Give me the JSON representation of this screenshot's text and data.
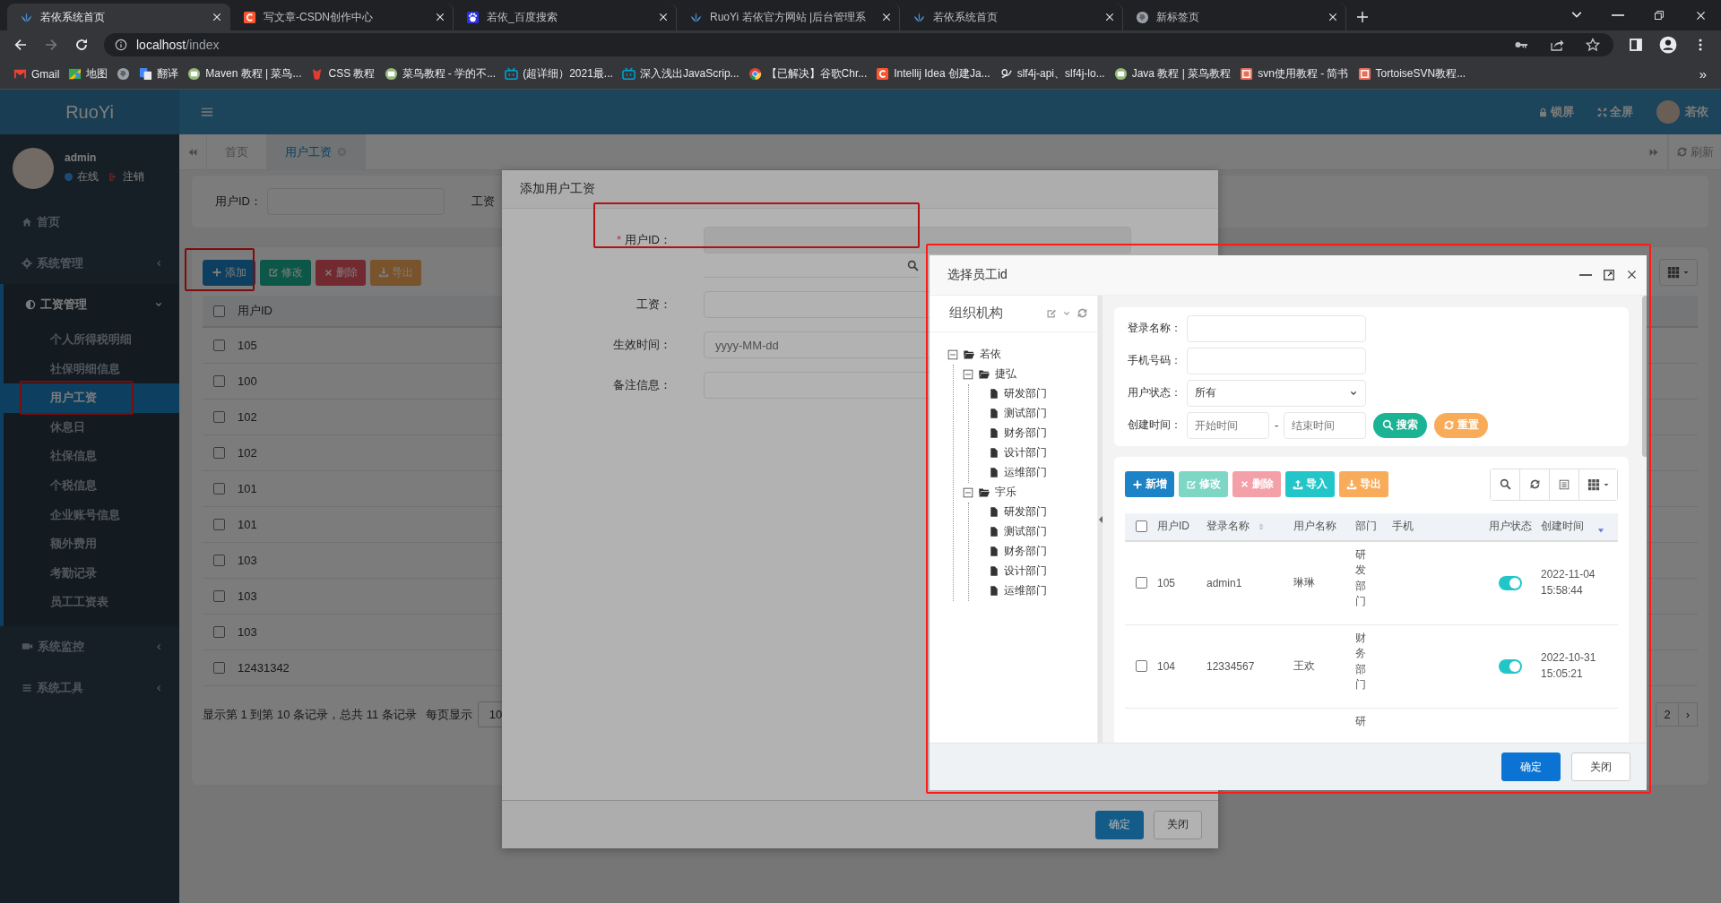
{
  "browser": {
    "tabs": [
      {
        "title": "若依系统首页",
        "selected": true
      },
      {
        "title": "写文章-CSDN创作中心",
        "selected": false
      },
      {
        "title": "若依_百度搜索",
        "selected": false
      },
      {
        "title": "RuoYi 若依官方网站 |后台管理系",
        "selected": false
      },
      {
        "title": "若依系统首页",
        "selected": false
      },
      {
        "title": "新标签页",
        "selected": false
      }
    ],
    "address_host": "localhost",
    "address_path": "/index",
    "bookmarks": [
      {
        "kind": "link",
        "label": "Gmail"
      },
      {
        "kind": "link",
        "label": "地图"
      },
      {
        "kind": "icon"
      },
      {
        "kind": "link",
        "label": "翻译"
      },
      {
        "kind": "link",
        "label": "Maven 教程 | 菜鸟..."
      },
      {
        "kind": "link",
        "label": "CSS 教程"
      },
      {
        "kind": "link",
        "label": "菜鸟教程 - 学的不..."
      },
      {
        "kind": "link",
        "label": "(超详细）2021最..."
      },
      {
        "kind": "link",
        "label": "深入浅出JavaScrip..."
      },
      {
        "kind": "link",
        "label": "【已解决】谷歌Chr..."
      },
      {
        "kind": "link",
        "label": "Intellij Idea 创建Ja..."
      },
      {
        "kind": "link",
        "label": "slf4j-api、slf4j-lo..."
      },
      {
        "kind": "link",
        "label": "Java 教程 | 菜鸟教程"
      },
      {
        "kind": "link",
        "label": "svn使用教程 - 简书"
      },
      {
        "kind": "link",
        "label": "TortoiseSVN教程..."
      }
    ],
    "more": "»"
  },
  "sidebar": {
    "logo": "RuoYi",
    "user": {
      "name": "admin",
      "status": "在线",
      "logout": "注销"
    },
    "items": [
      {
        "label": "首页"
      },
      {
        "label": "系统管理",
        "expanded": false
      },
      {
        "label": "工资管理",
        "expanded": true,
        "children": [
          {
            "label": "个人所得税明细",
            "selected": false
          },
          {
            "label": "社保明细信息",
            "selected": false
          },
          {
            "label": "用户工资",
            "selected": true,
            "highlighted": true
          },
          {
            "label": "休息日",
            "selected": false
          },
          {
            "label": "社保信息",
            "selected": false
          },
          {
            "label": "个税信息",
            "selected": false
          },
          {
            "label": "企业账号信息",
            "selected": false
          },
          {
            "label": "额外费用",
            "selected": false
          },
          {
            "label": "考勤记录",
            "selected": false
          },
          {
            "label": "员工工资表",
            "selected": false
          }
        ]
      },
      {
        "label": "系统监控",
        "expanded": false
      },
      {
        "label": "系统工具",
        "expanded": false
      }
    ]
  },
  "header": {
    "actions": [
      {
        "label": "锁屏"
      },
      {
        "label": "全屏"
      }
    ],
    "user": "若依"
  },
  "page_tabs": [
    {
      "label": "首页",
      "selected": false,
      "closable": false
    },
    {
      "label": "用户工资",
      "selected": true,
      "closable": true
    }
  ],
  "refresh": "刷新",
  "search": {
    "fields": [
      {
        "label": "用户ID："
      },
      {
        "label": "工资"
      }
    ]
  },
  "toolbar": [
    {
      "label": "添加",
      "kind": "primary",
      "highlighted": true
    },
    {
      "label": "修改",
      "kind": "success",
      "highlighted": false
    },
    {
      "label": "删除",
      "kind": "danger",
      "highlighted": false
    },
    {
      "label": "导出",
      "kind": "warning",
      "highlighted": false
    }
  ],
  "table": {
    "header_checked": false,
    "columns": [
      "用户ID"
    ],
    "rows": [
      {
        "cells": [
          "105"
        ],
        "checked": false
      },
      {
        "cells": [
          "100"
        ],
        "checked": false
      },
      {
        "cells": [
          "102"
        ],
        "checked": false
      },
      {
        "cells": [
          "102"
        ],
        "checked": false
      },
      {
        "cells": [
          "101"
        ],
        "checked": false
      },
      {
        "cells": [
          "101"
        ],
        "checked": false
      },
      {
        "cells": [
          "103"
        ],
        "checked": false
      },
      {
        "cells": [
          "103"
        ],
        "checked": false
      },
      {
        "cells": [
          "103"
        ],
        "checked": false
      },
      {
        "cells": [
          "12431342"
        ],
        "checked": false
      }
    ]
  },
  "pagination": {
    "summary": "显示第 1 到第 10 条记录，总共 11 条记录",
    "per_page_label": "每页显示",
    "per_page": "10",
    "pages": [
      {
        "label": "2",
        "selected": false
      },
      {
        "label": "›",
        "selected": false
      }
    ]
  },
  "dialog1": {
    "title": "添加用户工资",
    "fields": [
      {
        "label": "用户ID：",
        "required_mark": "*",
        "kind": "lookup",
        "highlighted": true
      },
      {
        "label": "工资：",
        "kind": "text"
      },
      {
        "label": "生效时间：",
        "kind": "text",
        "placeholder": "yyyy-MM-dd"
      },
      {
        "label": "备注信息：",
        "kind": "text"
      }
    ],
    "buttons": [
      {
        "label": "确定",
        "kind": "primary"
      },
      {
        "label": "关闭",
        "kind": "default"
      }
    ]
  },
  "dialog2": {
    "title": "选择员工id",
    "highlighted": true,
    "tree": {
      "title": "组织机构",
      "nodes": [
        {
          "label": "若依",
          "expanded": true,
          "children": [
            {
              "label": "捷弘",
              "expanded": true,
              "children": [
                {
                  "label": "研发部门"
                },
                {
                  "label": "测试部门"
                },
                {
                  "label": "财务部门"
                },
                {
                  "label": "设计部门"
                },
                {
                  "label": "运维部门"
                }
              ]
            },
            {
              "label": "宇乐",
              "expanded": true,
              "children": [
                {
                  "label": "研发部门"
                },
                {
                  "label": "测试部门"
                },
                {
                  "label": "财务部门"
                },
                {
                  "label": "设计部门"
                },
                {
                  "label": "运维部门"
                }
              ]
            }
          ]
        }
      ]
    },
    "form": {
      "fields": [
        {
          "label": "登录名称：",
          "kind": "text"
        },
        {
          "label": "手机号码：",
          "kind": "text"
        },
        {
          "label": "用户状态：",
          "kind": "select",
          "value": "所有"
        },
        {
          "label": "创建时间：",
          "kind": "range",
          "from_placeholder": "开始时间",
          "separator": "-",
          "to_placeholder": "结束时间"
        }
      ],
      "buttons": [
        {
          "label": "搜索",
          "kind": "search"
        },
        {
          "label": "重置",
          "kind": "reset"
        }
      ]
    },
    "toolbar": [
      {
        "label": "新增",
        "kind": "primary"
      },
      {
        "label": "修改",
        "kind": "success"
      },
      {
        "label": "删除",
        "kind": "danger"
      },
      {
        "label": "导入",
        "kind": "info"
      },
      {
        "label": "导出",
        "kind": "warning"
      }
    ],
    "table": {
      "header_checked": false,
      "columns": [
        {
          "label": "用户ID",
          "kind": "plain"
        },
        {
          "label": "登录名称",
          "kind": "sortable"
        },
        {
          "label": "用户名称",
          "kind": "plain"
        },
        {
          "label": "部门",
          "kind": "plain"
        },
        {
          "label": "手机",
          "kind": "plain"
        },
        {
          "label": "用户状态",
          "kind": "plain"
        },
        {
          "label": "创建时间",
          "kind": "sorted"
        }
      ],
      "rows": [
        {
          "checked": false,
          "id": "105",
          "login": "admin1",
          "name": "琳琳",
          "dept": "研发部门",
          "enabled": true,
          "created": "2022-11-04 15:58:44"
        },
        {
          "checked": false,
          "id": "104",
          "login": "12334567",
          "name": "王欢",
          "dept": "财务部门",
          "enabled": true,
          "created": "2022-10-31 15:05:21"
        },
        {
          "dept": "研"
        }
      ]
    },
    "buttons": [
      {
        "label": "确定",
        "kind": "primary"
      },
      {
        "label": "关闭",
        "kind": "default"
      }
    ]
  }
}
